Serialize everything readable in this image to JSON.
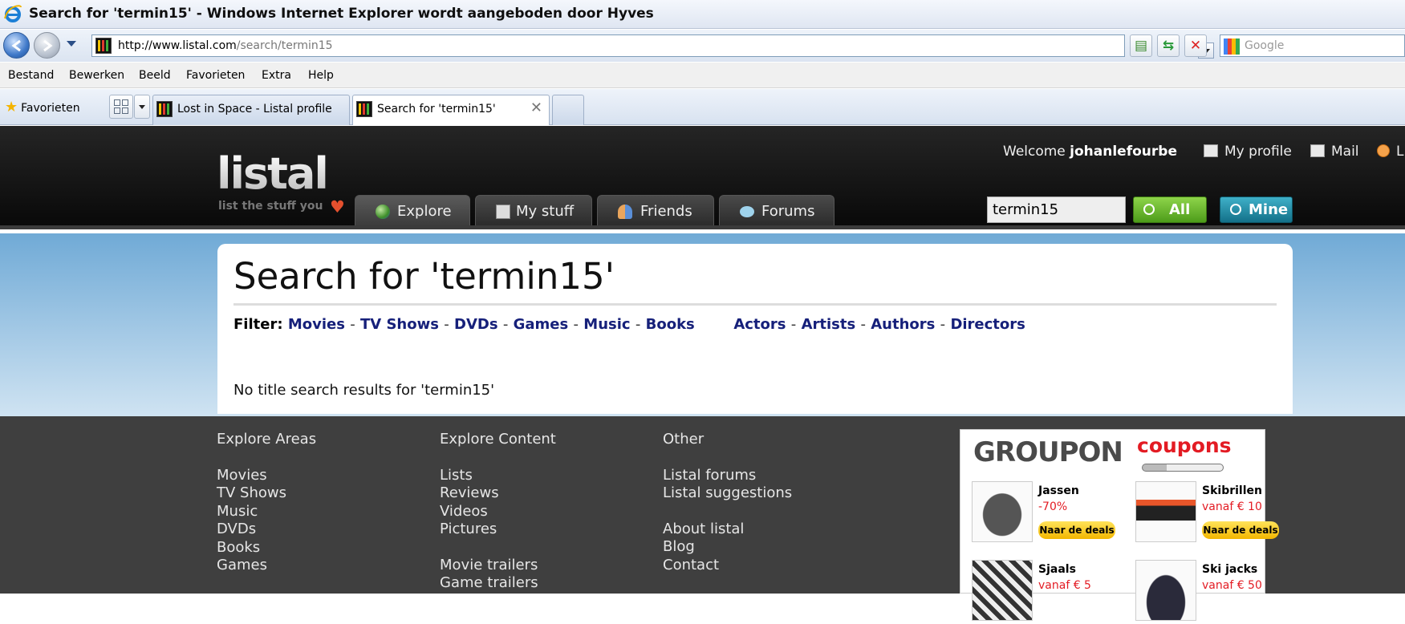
{
  "window": {
    "title": "Search for 'termin15' - Windows Internet Explorer wordt aangeboden door Hyves"
  },
  "address_bar": {
    "url_host": "http://www.listal.com",
    "url_path": "/search/termin15",
    "search_placeholder": "Google"
  },
  "menu": {
    "items": [
      "Bestand",
      "Bewerken",
      "Beeld",
      "Favorieten",
      "Extra",
      "Help"
    ]
  },
  "tabs_bar": {
    "favorites_label": "Favorieten",
    "tabs": [
      {
        "label": "Lost in Space - Listal profile"
      },
      {
        "label": "Search for 'termin15'",
        "close": "✕"
      }
    ]
  },
  "site": {
    "logo": "listal",
    "tagline": "list the stuff you",
    "nav": [
      {
        "label": "Explore",
        "icon": "globe-icon"
      },
      {
        "label": "My stuff",
        "icon": "stuff-icon"
      },
      {
        "label": "Friends",
        "icon": "friends-icon"
      },
      {
        "label": "Forums",
        "icon": "speech-bubble-icon"
      }
    ],
    "welcome_text": "Welcome",
    "username": "johanlefourbe",
    "links": {
      "profile": "My profile",
      "mail": "Mail",
      "logout": "L"
    },
    "search": {
      "value": "termin15",
      "all_label": "All",
      "mine_label": "Mine"
    }
  },
  "main": {
    "heading": "Search for 'termin15'",
    "filter_label": "Filter:",
    "filters_a": [
      "Movies",
      "TV Shows",
      "DVDs",
      "Games",
      "Music",
      "Books"
    ],
    "filters_b": [
      "Actors",
      "Artists",
      "Authors",
      "Directors"
    ],
    "separator": "-",
    "no_results": "No title search results for 'termin15'"
  },
  "footer": {
    "areas": {
      "title": "Explore Areas",
      "items": [
        "Movies",
        "TV Shows",
        "Music",
        "DVDs",
        "Books",
        "Games"
      ]
    },
    "content": {
      "title": "Explore Content",
      "items_a": [
        "Lists",
        "Reviews",
        "Videos",
        "Pictures"
      ],
      "items_b": [
        "Movie trailers",
        "Game trailers"
      ]
    },
    "other": {
      "title": "Other",
      "items_a": [
        "Listal forums",
        "Listal suggestions"
      ],
      "items_b": [
        "About listal",
        "Blog",
        "Contact"
      ]
    }
  },
  "ad": {
    "brand": "GROUPON",
    "sub": "coupons",
    "deals": [
      {
        "name": "Jassen",
        "price": "-70%",
        "button": "Naar de deals"
      },
      {
        "name": "Skibrillen",
        "price": "vanaf € 10",
        "button": "Naar de deals"
      },
      {
        "name": "Sjaals",
        "price": "vanaf € 5"
      },
      {
        "name": "Ski jacks",
        "price": "vanaf € 50"
      }
    ]
  },
  "colors": {
    "link": "#16207a",
    "header_bg": "#111111",
    "footer_bg": "#3f3f3f",
    "all_button": "#6bbb2f",
    "mine_button": "#1d8aa6",
    "groupon_red": "#e31b23"
  }
}
